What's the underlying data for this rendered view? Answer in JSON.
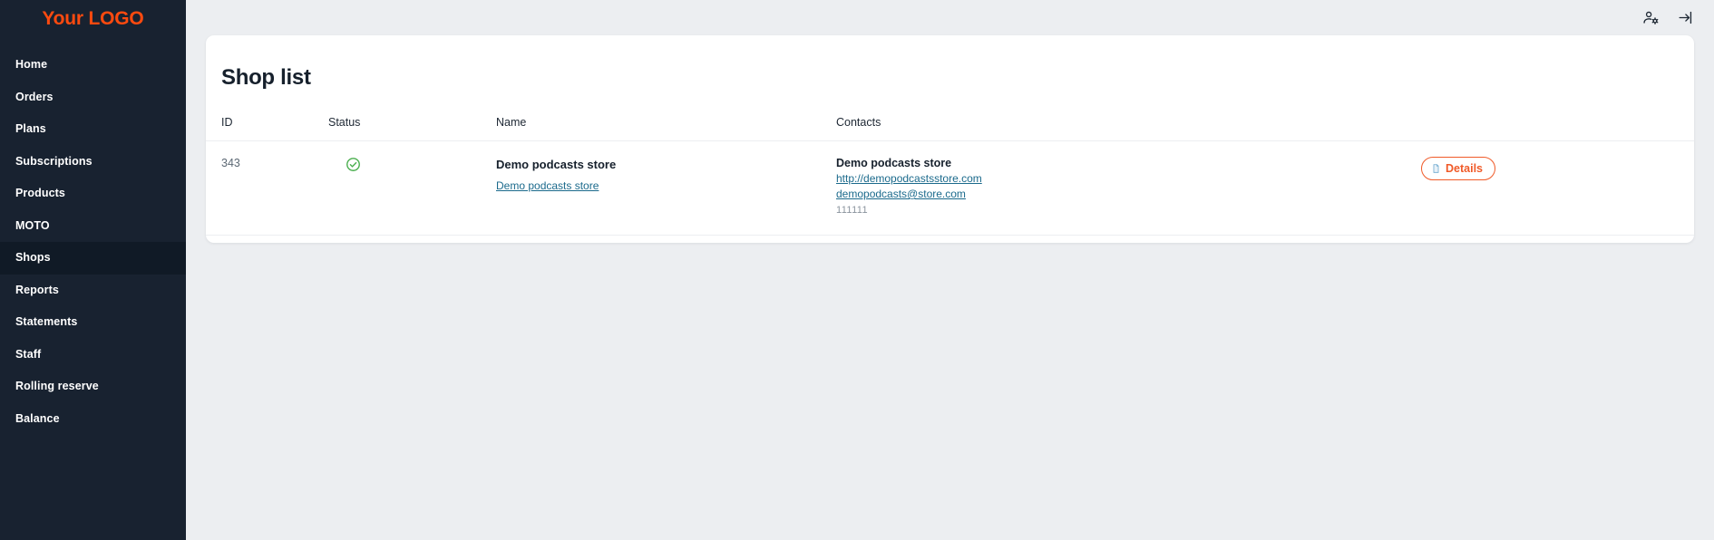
{
  "sidebar": {
    "logo": "Your LOGO",
    "items": [
      {
        "label": "Home",
        "active": false,
        "name": "home"
      },
      {
        "label": "Orders",
        "active": false,
        "name": "orders"
      },
      {
        "label": "Plans",
        "active": false,
        "name": "plans"
      },
      {
        "label": "Subscriptions",
        "active": false,
        "name": "subscriptions"
      },
      {
        "label": "Products",
        "active": false,
        "name": "products"
      },
      {
        "label": "MOTO",
        "active": false,
        "name": "moto"
      },
      {
        "label": "Shops",
        "active": true,
        "name": "shops"
      },
      {
        "label": "Reports",
        "active": false,
        "name": "reports"
      },
      {
        "label": "Statements",
        "active": false,
        "name": "statements"
      },
      {
        "label": "Staff",
        "active": false,
        "name": "staff"
      },
      {
        "label": "Rolling reserve",
        "active": false,
        "name": "rolling-reserve"
      },
      {
        "label": "Balance",
        "active": false,
        "name": "balance"
      }
    ]
  },
  "topbar": {
    "icons": [
      {
        "name": "account-settings-icon"
      },
      {
        "name": "logout-icon"
      }
    ]
  },
  "page": {
    "title": "Shop list"
  },
  "table": {
    "columns": [
      "ID",
      "Status",
      "Name",
      "Contacts",
      ""
    ],
    "rows": [
      {
        "id": "343",
        "status": "active",
        "status_icon": "check-circle-icon",
        "name": "Demo podcasts store",
        "name_link": "Demo podcasts store",
        "contact_name": "Demo podcasts store",
        "contact_url": "http://demopodcastsstore.com",
        "contact_email": "demopodcasts@store.com",
        "contact_phone": "111111",
        "action_label": "Details"
      }
    ]
  },
  "colors": {
    "sidebar_bg": "#182230",
    "sidebar_active_bg": "#101a26",
    "logo_orange": "#ff4a0f",
    "accent_orange": "#f05a28",
    "link_blue": "#1b6a8c",
    "status_green": "#4caf50",
    "page_bg": "#eceef1"
  }
}
